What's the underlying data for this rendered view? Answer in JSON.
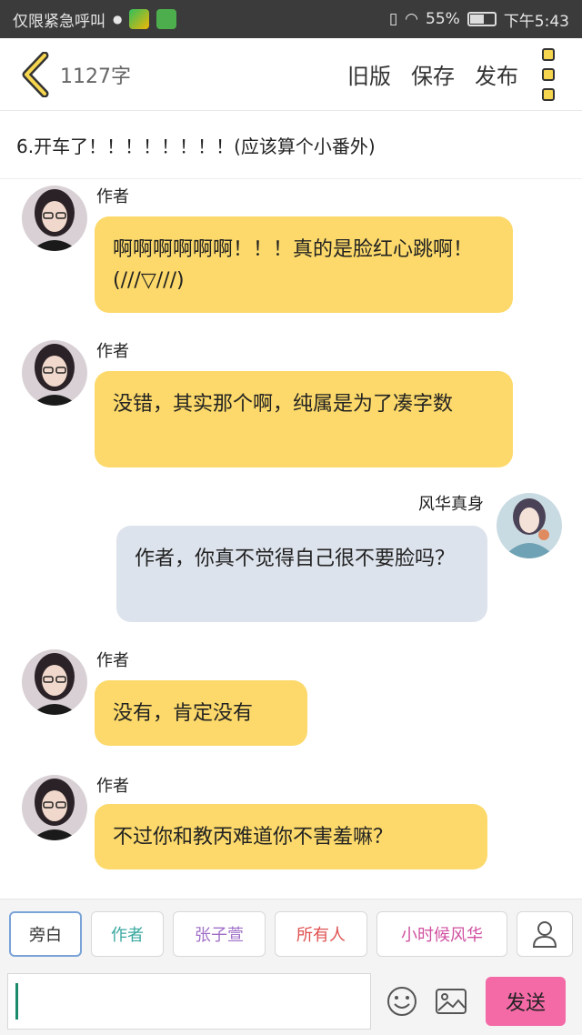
{
  "status_bar": {
    "carrier_text": "仅限紧急呼叫",
    "battery_percent": "55%",
    "battery_level": 0.55,
    "time": "下午5:43"
  },
  "header": {
    "word_count": "1127字",
    "actions": [
      "旧版",
      "保存",
      "发布"
    ]
  },
  "chapter": {
    "title": "6.开车了！！！！！！！！(应该算个小番外)"
  },
  "messages": [
    {
      "side": "left",
      "sender": "作者",
      "text": "啊啊啊啊啊啊！！！真的是脸红心跳啊！(///▽///)"
    },
    {
      "side": "left",
      "sender": "作者",
      "text": "没错，其实那个啊，纯属是为了凑字数"
    },
    {
      "side": "right",
      "sender": "风华真身",
      "text": "作者，你真不觉得自己很不要脸吗？"
    },
    {
      "side": "left",
      "sender": "作者",
      "text": "没有，肯定没有"
    },
    {
      "side": "left",
      "sender": "作者",
      "text": "不过你和教丙难道你不害羞嘛？"
    }
  ],
  "roles": [
    {
      "label": "旁白",
      "color": "#333333"
    },
    {
      "label": "作者",
      "color": "#3aa8a0"
    },
    {
      "label": "张子萱",
      "color": "#a070c8"
    },
    {
      "label": "所有人",
      "color": "#e05050"
    },
    {
      "label": "小时候风华",
      "color": "#d050a0"
    }
  ],
  "input": {
    "placeholder": "",
    "send_label": "发送"
  },
  "colors": {
    "bubble_left": "#fcd96a",
    "bubble_right": "#dde3ec",
    "send_button": "#f46aa7",
    "status_bar": "#3b3b3b"
  },
  "icons": {
    "back": "chevron-left-icon",
    "more": "more-vertical-icon",
    "add_role": "user-icon",
    "emoji": "emoji-icon",
    "image": "image-icon"
  }
}
